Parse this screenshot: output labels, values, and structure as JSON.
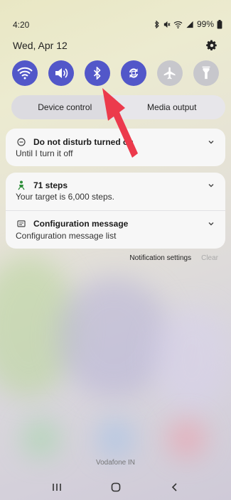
{
  "status_bar": {
    "time": "4:20",
    "battery": "99%"
  },
  "header": {
    "date": "Wed, Apr 12"
  },
  "quick_tiles": [
    {
      "name": "wifi",
      "state": "on"
    },
    {
      "name": "sound",
      "state": "on"
    },
    {
      "name": "bluetooth",
      "state": "on"
    },
    {
      "name": "auto-rotate",
      "state": "on"
    },
    {
      "name": "airplane-mode",
      "state": "off"
    },
    {
      "name": "flashlight",
      "state": "off"
    }
  ],
  "controls": {
    "device_control": "Device control",
    "media_output": "Media output"
  },
  "notifications": {
    "dnd": {
      "title": "Do not disturb turned on",
      "text": "Until I turn it off"
    },
    "steps": {
      "title": "71 steps",
      "text": "Your target is 6,000 steps."
    },
    "config": {
      "title": "Configuration message",
      "text": "Configuration message list"
    }
  },
  "actions": {
    "settings": "Notification settings",
    "clear": "Clear"
  },
  "carrier": "Vodafone IN",
  "colors": {
    "accent": "#5257c9",
    "tile_off": "#c7c7cc",
    "arrow": "#ec3a4c"
  }
}
